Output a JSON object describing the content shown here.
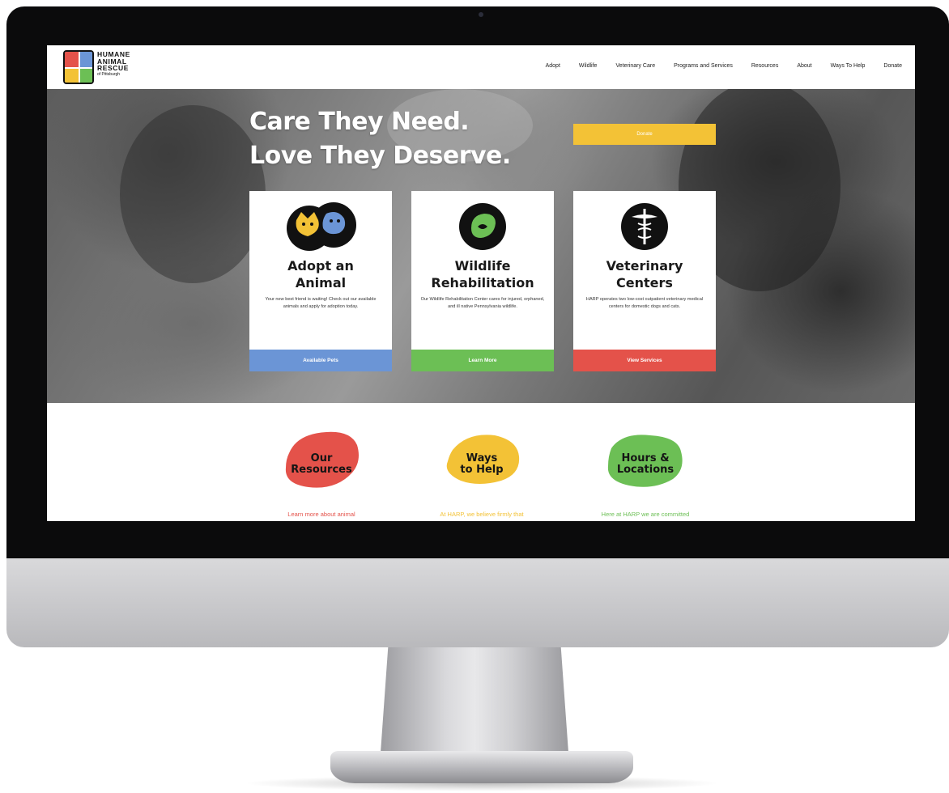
{
  "site": {
    "logo": {
      "lines": [
        "HUMANE",
        "ANIMAL",
        "RESCUE"
      ],
      "subline": "of Pittsburgh"
    },
    "nav": [
      "Adopt",
      "Wildlife",
      "Veterinary Care",
      "Programs and Services",
      "Resources",
      "About",
      "Ways To Help",
      "Donate"
    ]
  },
  "hero": {
    "title_line1": "Care They Need.",
    "title_line2": "Love They Deserve.",
    "donate_label": "Donate"
  },
  "cards": [
    {
      "title_line1": "Adopt an",
      "title_line2": "Animal",
      "description": "Your new best friend is waiting! Check out our available animals and apply for adoption today.",
      "button": "Available Pets",
      "icon": "cat-dog-icon",
      "color": "#6b95d6"
    },
    {
      "title_line1": "Wildlife",
      "title_line2": "Rehabilitation",
      "description": "Our Wildlife Rehabilitation Center cares for injured, orphaned, and ill native Pennsylvania wildlife.",
      "button": "Learn More",
      "icon": "bird-icon",
      "color": "#6cbf55"
    },
    {
      "title_line1": "Veterinary",
      "title_line2": "Centers",
      "description": "HARP operates two low-cost outpatient veterinary medical centers for domestic dogs and cats.",
      "button": "View Services",
      "icon": "caduceus-icon",
      "color": "#e4524a"
    }
  ],
  "features": [
    {
      "title_line1": "Our",
      "title_line2": "Resources",
      "text": "Learn more about animal",
      "color": "#e4524a"
    },
    {
      "title_line1": "Ways",
      "title_line2": "to Help",
      "text": "At HARP, we believe firmly that",
      "color": "#f3c236"
    },
    {
      "title_line1": "Hours &",
      "title_line2": "Locations",
      "text": "Here at HARP we are committed",
      "color": "#6cbf55"
    }
  ]
}
